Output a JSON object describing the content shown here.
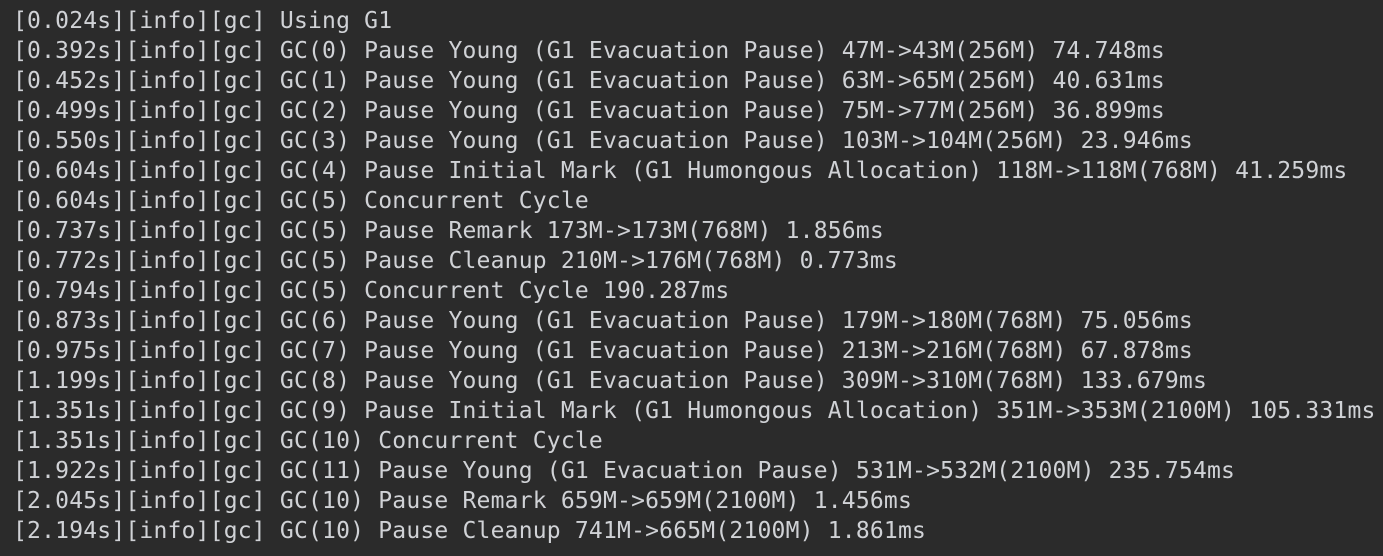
{
  "terminal": {
    "lines": [
      "[0.024s][info][gc] Using G1",
      "[0.392s][info][gc] GC(0) Pause Young (G1 Evacuation Pause) 47M->43M(256M) 74.748ms",
      "[0.452s][info][gc] GC(1) Pause Young (G1 Evacuation Pause) 63M->65M(256M) 40.631ms",
      "[0.499s][info][gc] GC(2) Pause Young (G1 Evacuation Pause) 75M->77M(256M) 36.899ms",
      "[0.550s][info][gc] GC(3) Pause Young (G1 Evacuation Pause) 103M->104M(256M) 23.946ms",
      "[0.604s][info][gc] GC(4) Pause Initial Mark (G1 Humongous Allocation) 118M->118M(768M) 41.259ms",
      "[0.604s][info][gc] GC(5) Concurrent Cycle",
      "[0.737s][info][gc] GC(5) Pause Remark 173M->173M(768M) 1.856ms",
      "[0.772s][info][gc] GC(5) Pause Cleanup 210M->176M(768M) 0.773ms",
      "[0.794s][info][gc] GC(5) Concurrent Cycle 190.287ms",
      "[0.873s][info][gc] GC(6) Pause Young (G1 Evacuation Pause) 179M->180M(768M) 75.056ms",
      "[0.975s][info][gc] GC(7) Pause Young (G1 Evacuation Pause) 213M->216M(768M) 67.878ms",
      "[1.199s][info][gc] GC(8) Pause Young (G1 Evacuation Pause) 309M->310M(768M) 133.679ms",
      "[1.351s][info][gc] GC(9) Pause Initial Mark (G1 Humongous Allocation) 351M->353M(2100M) 105.331ms",
      "[1.351s][info][gc] GC(10) Concurrent Cycle",
      "[1.922s][info][gc] GC(11) Pause Young (G1 Evacuation Pause) 531M->532M(2100M) 235.754ms",
      "[2.045s][info][gc] GC(10) Pause Remark 659M->659M(2100M) 1.456ms",
      "[2.194s][info][gc] GC(10) Pause Cleanup 741M->665M(2100M) 1.861ms"
    ]
  },
  "colors": {
    "background": "#2b2b2b",
    "text": "#d0d2d6"
  }
}
